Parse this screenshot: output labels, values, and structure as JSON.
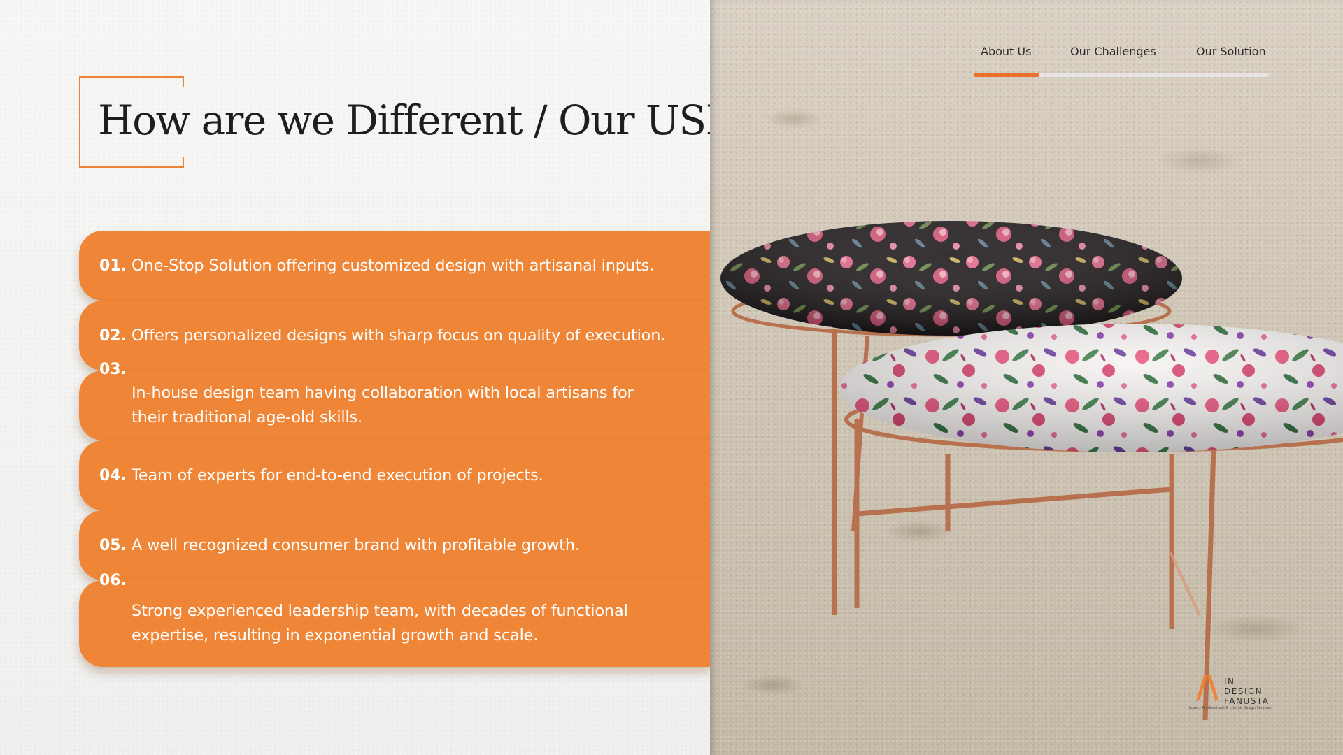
{
  "heading": {
    "title": "How are we Different / Our USP’s"
  },
  "nav": {
    "tabs": [
      {
        "label": "About Us",
        "active": true
      },
      {
        "label": "Our Challenges",
        "active": false
      },
      {
        "label": "Our Solution",
        "active": false
      }
    ]
  },
  "usps": [
    {
      "number": "01.",
      "text": "One-Stop Solution offering customized design with artisanal inputs."
    },
    {
      "number": "02.",
      "text": "Offers personalized designs with sharp focus on quality of execution."
    },
    {
      "number": "03.",
      "text": "In-house design team having collaboration with local artisans for their traditional age-old skills."
    },
    {
      "number": "04.",
      "text": "Team of experts for end-to-end execution of projects."
    },
    {
      "number": "05.",
      "text": "A well recognized consumer brand with profitable growth."
    },
    {
      "number": "06.",
      "text": "Strong experienced leadership team, with decades of functional expertise, resulting in exponential growth and scale."
    }
  ],
  "logo": {
    "line1": "IN",
    "line2": "DESIGN",
    "line3": "FANUSTA",
    "tagline": "Luxury Architectural & Interior Design Services"
  },
  "colors": {
    "accent": "#ef8536",
    "nav_indicator": "#ec6f2d",
    "title": "#1e1e1e"
  }
}
